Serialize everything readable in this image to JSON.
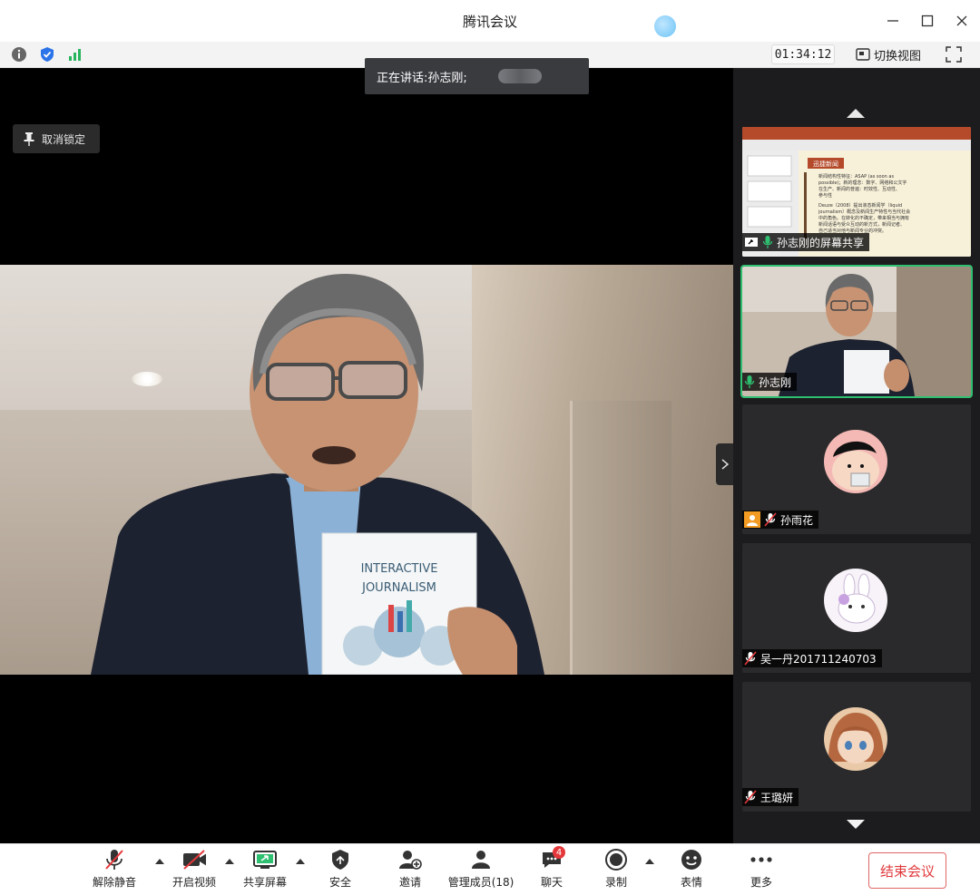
{
  "window": {
    "title": "腾讯会议"
  },
  "statusbar": {
    "timer": "01:34:12",
    "switch_view_label": "切换视图"
  },
  "stage": {
    "speaker_prefix": "正在讲话: ",
    "speaker_name": "孙志刚;",
    "pin_label": "取消锁定",
    "book_title_line1": "INTERACTIVE",
    "book_title_line2": "JOURNALISM"
  },
  "participants": [
    {
      "label": "孙志刚的屏幕共享",
      "kind": "screen-share"
    },
    {
      "label": "孙志刚",
      "kind": "video",
      "mic": "on"
    },
    {
      "label": "孙雨花",
      "kind": "avatar",
      "mic": "muted"
    },
    {
      "label": "吴一丹201711240703",
      "kind": "avatar",
      "mic": "muted"
    },
    {
      "label": "王璐妍",
      "kind": "avatar",
      "mic": "muted"
    }
  ],
  "slide": {
    "heading": "迅捷新闻",
    "lines": [
      "新闻结构性特征：ASAP (as soon as",
      "possible)；新的理念：数字、网络和公文字",
      "在生产、新闻的普遍：时效性、互动性、",
      "参与性",
      "Deuze（2008）提出液态新闻学（liquid",
      "journalism）概念及新闻生产特性与当代社会",
      "中的角色。在转化的不确定，带来相当与拥有",
      "新闻话语与受众互动的新方式，新闻记者、",
      "自己适当对他与新闻专业的冲突。"
    ]
  },
  "toolbar": {
    "unmute": "解除静音",
    "start_video": "开启视频",
    "share_screen": "共享屏幕",
    "security": "安全",
    "invite": "邀请",
    "manage_members": "管理成员(18)",
    "chat": "聊天",
    "chat_badge": "4",
    "record": "录制",
    "emoji": "表情",
    "more": "更多",
    "end_meeting": "结束会议"
  },
  "colors": {
    "accent_green": "#2fbf70",
    "end_red": "#e0393c",
    "badge_red": "#e5383b",
    "dark_panel": "#1c1c1e"
  }
}
